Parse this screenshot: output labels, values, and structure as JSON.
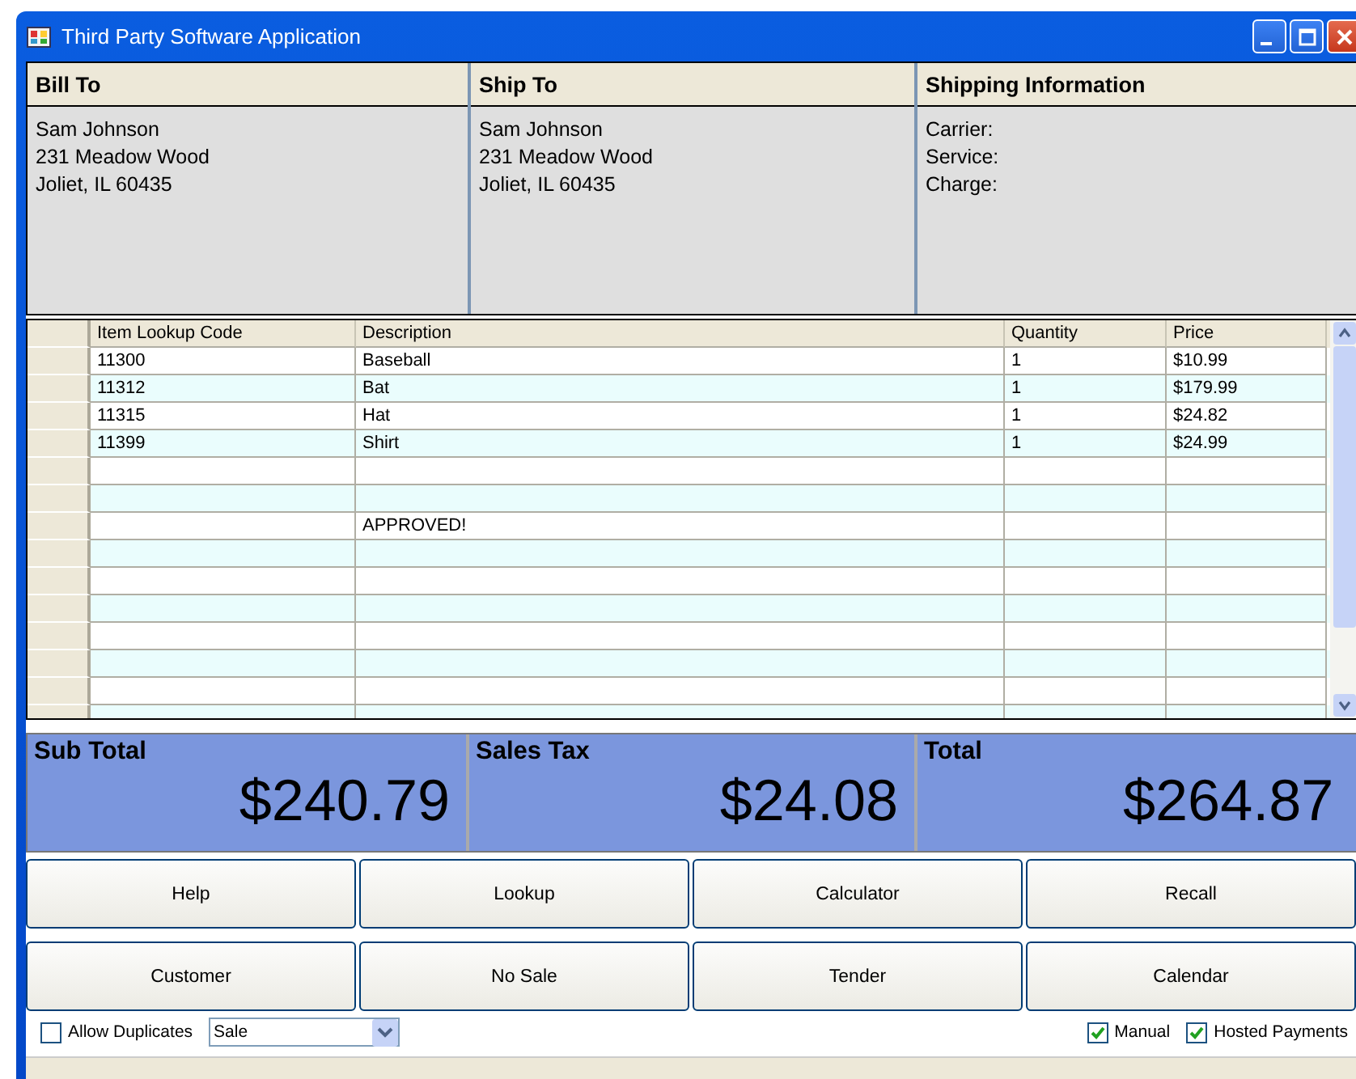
{
  "window": {
    "title": "Third Party Software Application"
  },
  "panels": [
    {
      "title": "Bill To",
      "lines": [
        "Sam Johnson",
        "231 Meadow Wood",
        "Joliet, IL 60435"
      ]
    },
    {
      "title": "Ship To",
      "lines": [
        "Sam Johnson",
        "231 Meadow Wood",
        "Joliet, IL 60435"
      ]
    },
    {
      "title": "Shipping Information",
      "lines": [
        "Carrier:",
        "Service:",
        "Charge:"
      ]
    }
  ],
  "table": {
    "columns": [
      "Item Lookup Code",
      "Description",
      "Quantity",
      "Price"
    ],
    "rows": [
      {
        "code": "11300",
        "description": "Baseball",
        "quantity": "1",
        "price": "$10.99"
      },
      {
        "code": "11312",
        "description": "Bat",
        "quantity": "1",
        "price": "$179.99"
      },
      {
        "code": "11315",
        "description": "Hat",
        "quantity": "1",
        "price": "$24.82"
      },
      {
        "code": "11399",
        "description": "Shirt",
        "quantity": "1",
        "price": "$24.99"
      },
      {},
      {},
      {
        "description": "APPROVED!"
      }
    ]
  },
  "totals": [
    {
      "label": "Sub Total",
      "value": "$240.79"
    },
    {
      "label": "Sales Tax",
      "value": "$24.08"
    },
    {
      "label": "Total",
      "value": "$264.87"
    }
  ],
  "buttons": [
    "Help",
    "Lookup",
    "Calculator",
    "Recall",
    "Customer",
    "No Sale",
    "Tender",
    "Calendar"
  ],
  "options": {
    "allow_duplicates": {
      "label": "Allow Duplicates",
      "checked": false
    },
    "mode": {
      "value": "Sale"
    },
    "manual": {
      "label": "Manual",
      "checked": true
    },
    "hosted_payments": {
      "label": "Hosted Payments",
      "checked": true
    }
  }
}
